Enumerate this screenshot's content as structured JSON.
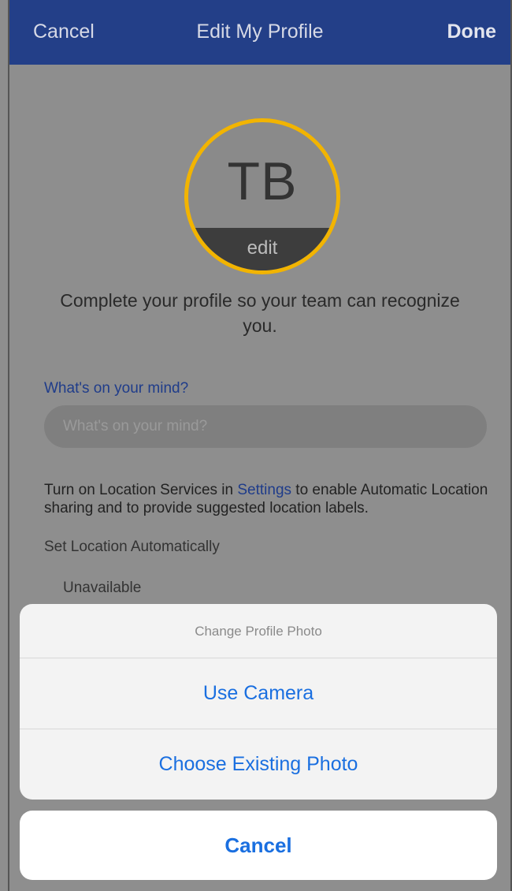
{
  "navbar": {
    "cancel_label": "Cancel",
    "title": "Edit My Profile",
    "done_label": "Done"
  },
  "avatar": {
    "initials": "TB",
    "edit_label": "edit",
    "ring_color": "#f2b400"
  },
  "prompt": "Complete your profile so your team can recognize you.",
  "status": {
    "label": "What's on your mind?",
    "placeholder": "What's on your mind?"
  },
  "location": {
    "text_before": "Turn on Location Services in ",
    "settings_link": "Settings",
    "text_after": " to enable Automatic Location sharing and to provide suggested location labels.",
    "auto_label": "Set Location Automatically",
    "unavailable": "Unavailable"
  },
  "action_sheet": {
    "title": "Change Profile Photo",
    "options": [
      "Use Camera",
      "Choose Existing Photo"
    ],
    "cancel_label": "Cancel"
  },
  "colors": {
    "navbar": "#233f88",
    "action_blue": "#1a6fe0",
    "accent_link": "#1f3c8a"
  }
}
